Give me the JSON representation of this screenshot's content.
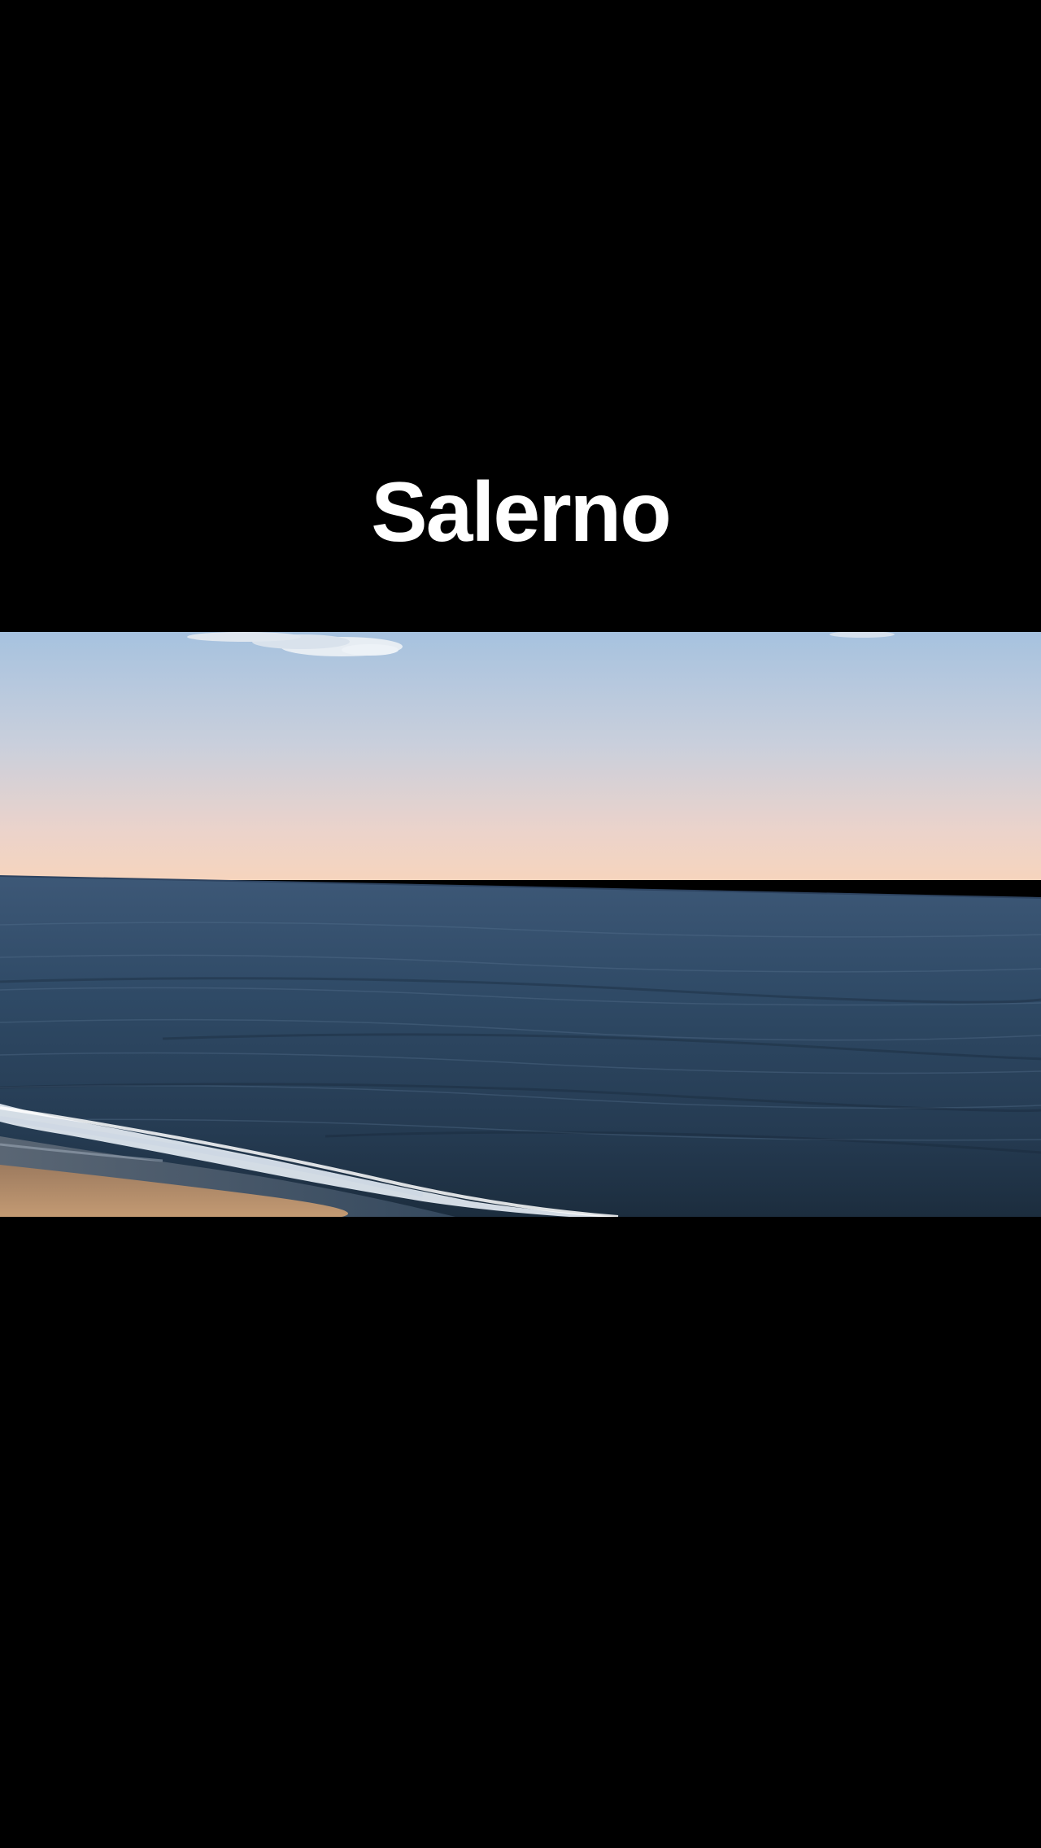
{
  "caption": {
    "title": "Salerno"
  },
  "colors": {
    "background": "#000000",
    "caption_text": "#ffffff",
    "sky_top": "#a9c4df",
    "sky_bottom": "#f4d3bf",
    "sea_far": "#3c5573",
    "sea_near": "#1e3042",
    "foam": "#e8eef4",
    "sand": "#b08a68"
  }
}
